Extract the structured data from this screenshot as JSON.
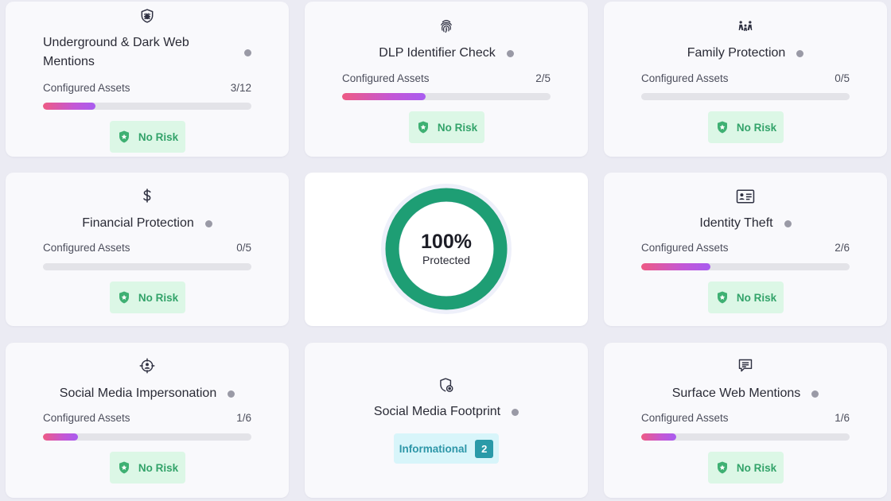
{
  "colors": {
    "accent_green": "#1e9e74",
    "badge_green_bg": "#dcf7e6",
    "badge_green_text": "#33a36a",
    "info_bg": "#d8f5fa",
    "info_text": "#2d96a8",
    "bar_start": "#ee5a84",
    "bar_end": "#a85cf0"
  },
  "cards": [
    {
      "icon": "bug-shield-icon",
      "title": "Underground & Dark Web Mentions",
      "assets_label": "Configured Assets",
      "configured": 3,
      "total": 12,
      "count": "3/12",
      "status": "No Risk"
    },
    {
      "icon": "fingerprint-icon",
      "title": "DLP Identifier Check",
      "assets_label": "Configured Assets",
      "configured": 2,
      "total": 5,
      "count": "2/5",
      "status": "No Risk"
    },
    {
      "icon": "family-icon",
      "title": "Family Protection",
      "assets_label": "Configured Assets",
      "configured": 0,
      "total": 5,
      "count": "0/5",
      "status": "No Risk"
    },
    {
      "icon": "dollar-icon",
      "title": "Financial Protection",
      "assets_label": "Configured Assets",
      "configured": 0,
      "total": 5,
      "count": "0/5",
      "status": "No Risk"
    },
    {
      "icon": "id-card-icon",
      "title": "Identity Theft",
      "assets_label": "Configured Assets",
      "configured": 2,
      "total": 6,
      "count": "2/6",
      "status": "No Risk"
    },
    {
      "icon": "crosshair-user-icon",
      "title": "Social Media Impersonation",
      "assets_label": "Configured Assets",
      "configured": 1,
      "total": 6,
      "count": "1/6",
      "status": "No Risk"
    },
    {
      "icon": "chat-lines-icon",
      "title": "Surface Web Mentions",
      "assets_label": "Configured Assets",
      "configured": 1,
      "total": 6,
      "count": "1/6",
      "status": "No Risk"
    }
  ],
  "summary": {
    "percent": 100,
    "percent_label": "100%",
    "label": "Protected"
  },
  "footprint": {
    "icon": "shield-settings-icon",
    "title": "Social Media Footprint",
    "status": "Informational",
    "count": "2"
  }
}
